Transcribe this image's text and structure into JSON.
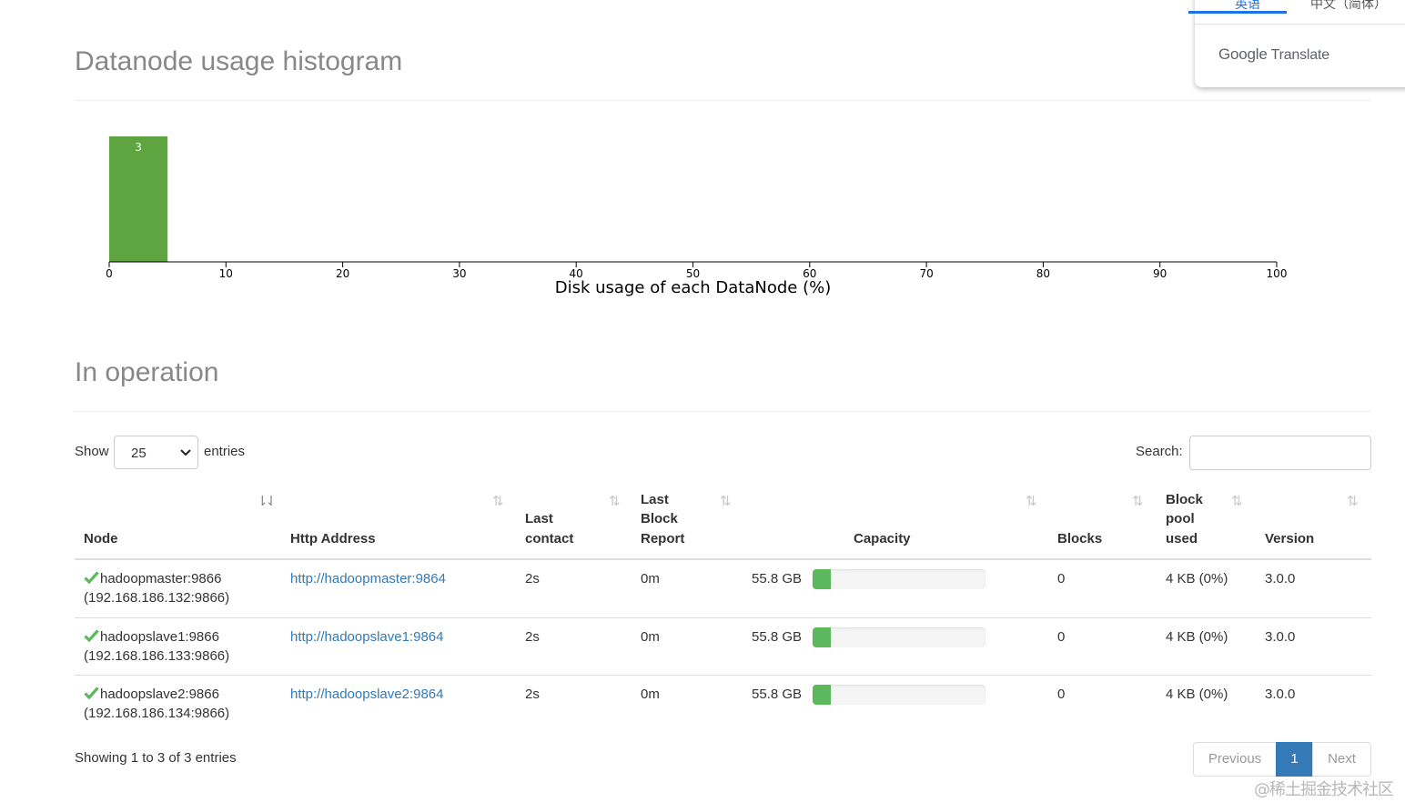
{
  "translate_popup": {
    "tab_left": "英语",
    "tab_right": "中文（简体）",
    "brand_google": "Google",
    "brand_translate": "Translate"
  },
  "histogram": {
    "title": "Datanode usage histogram",
    "chart_data": {
      "type": "bar",
      "title": "",
      "xlabel": "Disk usage of each DataNode (%)",
      "ylabel": "",
      "xlim": [
        0,
        100
      ],
      "x_ticks": [
        "0",
        "10",
        "20",
        "30",
        "40",
        "50",
        "60",
        "70",
        "80",
        "90",
        "100"
      ],
      "bins": [
        {
          "x0": 0,
          "x1": 5,
          "count": 3,
          "label": "3"
        }
      ],
      "bar_color": "#5ea541",
      "grid": false,
      "legend": "none"
    }
  },
  "operation": {
    "title": "In operation",
    "show_label": "Show",
    "page_length": "25",
    "entries_label": "entries",
    "search_label": "Search:",
    "search_value": "",
    "columns": [
      {
        "label": "Node",
        "sort": "active"
      },
      {
        "label": "Http Address",
        "sort": "both"
      },
      {
        "label": "Last contact",
        "sort": "both"
      },
      {
        "label": "Last Block Report",
        "sort": "both"
      },
      {
        "label": "Capacity",
        "sort": "both"
      },
      {
        "label": "Blocks",
        "sort": "both"
      },
      {
        "label": "Block pool used",
        "sort": "both"
      },
      {
        "label": "Version",
        "sort": "both"
      }
    ],
    "header_lines": {
      "node": "Node",
      "http": "Http Address",
      "last_contact_1": "Last",
      "last_contact_2": "contact",
      "last_block_1": "Last",
      "last_block_2": "Block",
      "last_block_3": "Report",
      "capacity": "Capacity",
      "blocks": "Blocks",
      "bpu_1": "Block",
      "bpu_2": "pool",
      "bpu_3": "used",
      "version": "Version"
    },
    "rows": [
      {
        "node": "hadoopmaster:9866",
        "ip": "(192.168.186.132:9866)",
        "http": "http://hadoopmaster:9864",
        "last_contact": "2s",
        "last_block_report": "0m",
        "capacity": "55.8 GB",
        "used_fraction": 0.02,
        "blocks": "0",
        "block_pool_used": "4 KB (0%)",
        "version": "3.0.0",
        "status_color": "#5cb85c"
      },
      {
        "node": "hadoopslave1:9866",
        "ip": "(192.168.186.133:9866)",
        "http": "http://hadoopslave1:9864",
        "last_contact": "2s",
        "last_block_report": "0m",
        "capacity": "55.8 GB",
        "used_fraction": 0.02,
        "blocks": "0",
        "block_pool_used": "4 KB (0%)",
        "version": "3.0.0",
        "status_color": "#5cb85c"
      },
      {
        "node": "hadoopslave2:9866",
        "ip": "(192.168.186.134:9866)",
        "http": "http://hadoopslave2:9864",
        "last_contact": "2s",
        "last_block_report": "0m",
        "capacity": "55.8 GB",
        "used_fraction": 0.02,
        "blocks": "0",
        "block_pool_used": "4 KB (0%)",
        "version": "3.0.0",
        "status_color": "#5cb85c"
      }
    ],
    "info": "Showing 1 to 3 of 3 entries",
    "pagination": {
      "previous": "Previous",
      "current": "1",
      "next": "Next"
    }
  },
  "watermark": "@稀土掘金技术社区",
  "icons": {
    "status": "check-icon",
    "sort": "sort-icon",
    "select": "chevron-down-icon"
  }
}
